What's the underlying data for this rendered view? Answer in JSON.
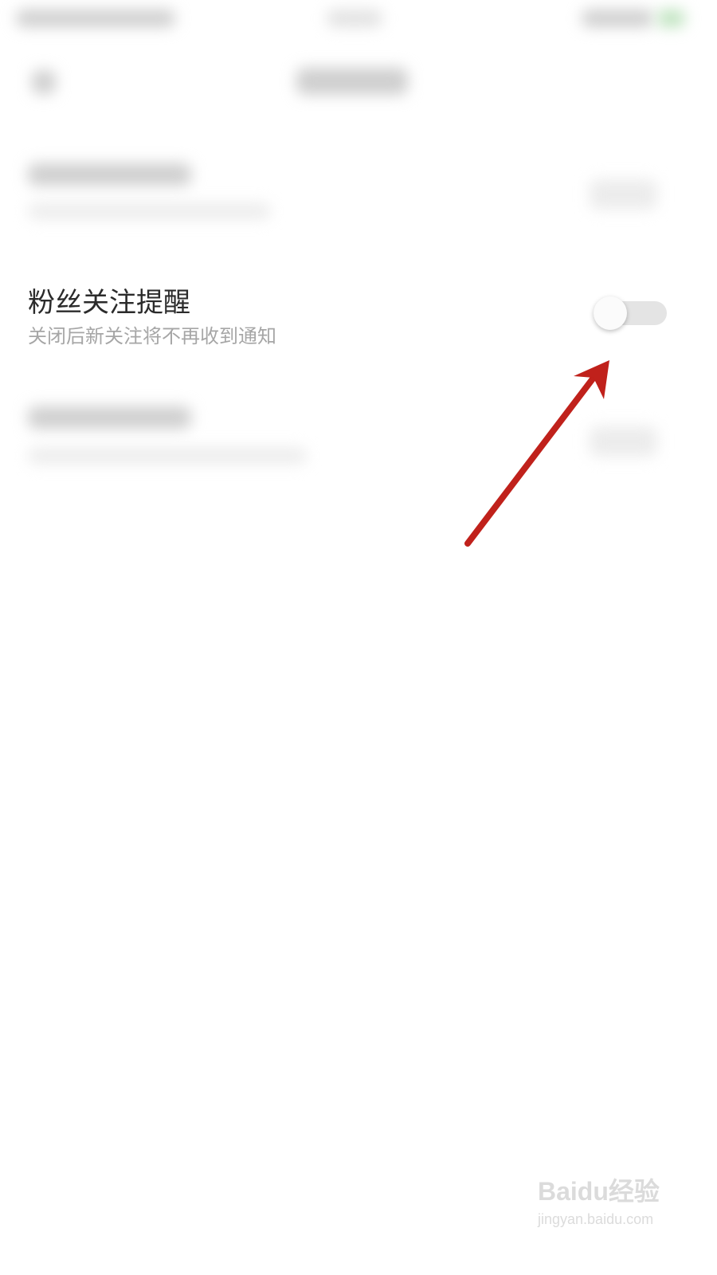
{
  "fan_follow_setting": {
    "title": "粉丝关注提醒",
    "description": "关闭后新关注将不再收到通知",
    "enabled": false
  },
  "colors": {
    "title": "#2b2b2b",
    "description": "#a6a6a6",
    "toggle_track_off": "#e4e4e4",
    "annotation_arrow": "#c0211b"
  },
  "watermark": {
    "logo": "Baidu经验",
    "url": "jingyan.baidu.com"
  }
}
